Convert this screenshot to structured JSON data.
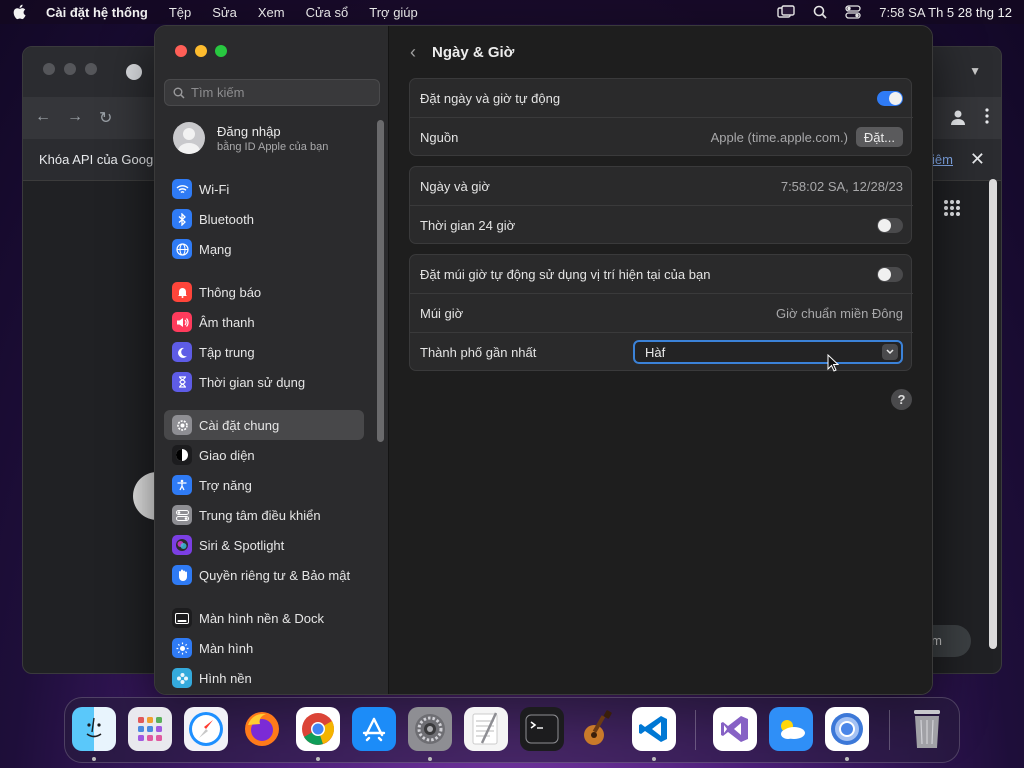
{
  "menubar": {
    "app_name": "Cài đặt hệ thống",
    "items": [
      "Tệp",
      "Sửa",
      "Xem",
      "Cửa sổ",
      "Trợ giúp"
    ],
    "clock": "7:58 SA Th 5 28 thg 12"
  },
  "chrome": {
    "infobar_text": "Khóa API của Goog",
    "infobar_link": "iêm",
    "pill_text": "ium"
  },
  "sidebar": {
    "search_placeholder": "Tìm kiếm",
    "account": {
      "name": "Đăng nhập",
      "subtitle": "bằng ID Apple của bạn"
    },
    "items": [
      {
        "label": "Wi-Fi",
        "icon": "wifi-icon",
        "color": "#2f7bf5"
      },
      {
        "label": "Bluetooth",
        "icon": "bluetooth-icon",
        "color": "#2f7bf5"
      },
      {
        "label": "Mạng",
        "icon": "globe-icon",
        "color": "#2f7bf5"
      },
      {
        "label": "Thông báo",
        "icon": "bell-icon",
        "color": "#ff453a"
      },
      {
        "label": "Âm thanh",
        "icon": "speaker-icon",
        "color": "#ff3b5c"
      },
      {
        "label": "Tập trung",
        "icon": "moon-icon",
        "color": "#5e5ce6"
      },
      {
        "label": "Thời gian sử dụng",
        "icon": "hourglass-icon",
        "color": "#5e5ce6"
      },
      {
        "label": "Cài đặt chung",
        "icon": "gear-icon",
        "color": "#8e8e93"
      },
      {
        "label": "Giao diện",
        "icon": "appearance-icon",
        "color": "#1c1c1e"
      },
      {
        "label": "Trợ năng",
        "icon": "accessibility-icon",
        "color": "#2f7bf5"
      },
      {
        "label": "Trung tâm điều khiển",
        "icon": "control-center-icon",
        "color": "#8e8e93"
      },
      {
        "label": "Siri & Spotlight",
        "icon": "siri-icon",
        "color": "#7b3fe4"
      },
      {
        "label": "Quyền riêng tư & Bảo mật",
        "icon": "hand-icon",
        "color": "#2f7bf5"
      },
      {
        "label": "Màn hình nền & Dock",
        "icon": "dock-icon",
        "color": "#1c1c1e"
      },
      {
        "label": "Màn hình",
        "icon": "sun-icon",
        "color": "#2f7bf5"
      },
      {
        "label": "Hình nền",
        "icon": "flower-icon",
        "color": "#34aadc"
      }
    ]
  },
  "main": {
    "title": "Ngày & Giờ",
    "auto_date_label": "Đặt ngày và giờ tự động",
    "auto_date_on": true,
    "source_label": "Nguồn",
    "source_value": "Apple (time.apple.com.)",
    "set_button": "Đặt...",
    "datetime_label": "Ngày và giờ",
    "datetime_value": "7:58:02 SA, 12/28/23",
    "h24_label": "Thời gian 24 giờ",
    "h24_on": false,
    "auto_tz_label": "Đặt múi giờ tự động sử dụng vị trí hiện tại của bạn",
    "auto_tz_on": false,
    "tz_label": "Múi giờ",
    "tz_value": "Giờ chuẩn miền Đông",
    "city_label": "Thành phố gần nhất",
    "city_value": "Hàf",
    "help_label": "?"
  },
  "dock": {
    "apps": [
      "Finder",
      "Launchpad",
      "Safari",
      "Firefox",
      "Chrome",
      "App Store",
      "System Settings",
      "TextEdit",
      "Terminal",
      "GarageBand",
      "VS Code",
      "Visual Studio",
      "Weather",
      "Chrome Canary",
      "Trash"
    ]
  }
}
